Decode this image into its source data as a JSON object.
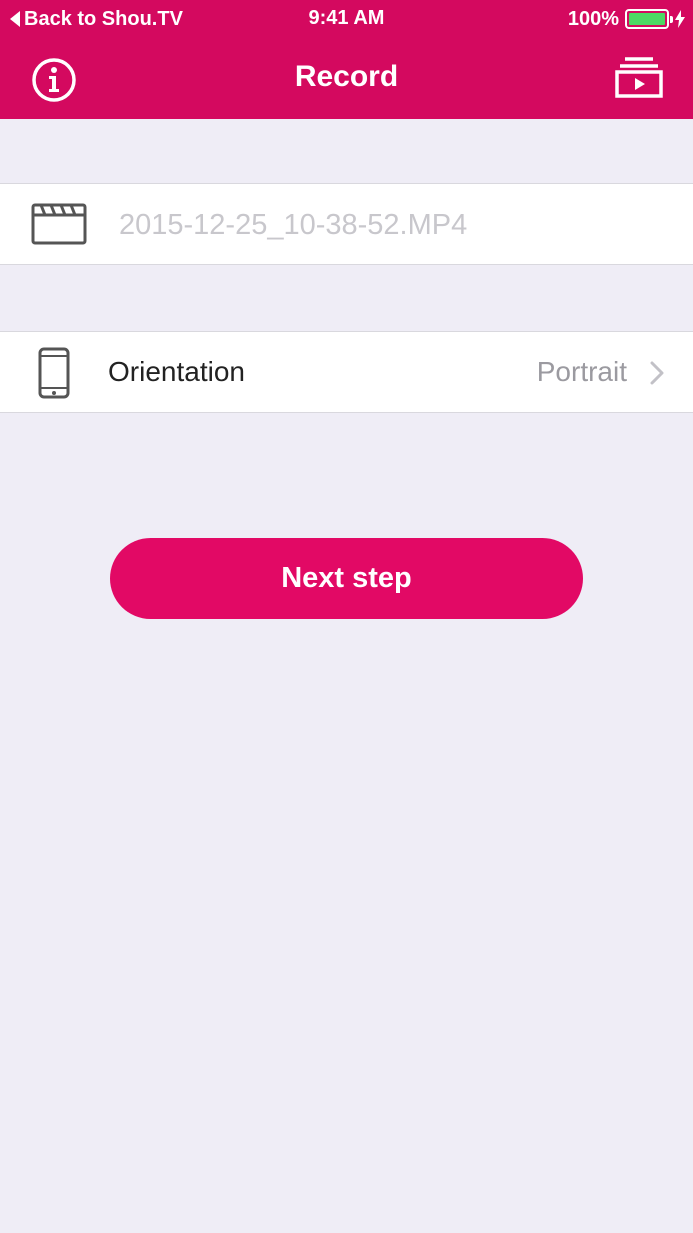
{
  "status_bar": {
    "back_app": "Back to Shou.TV",
    "time": "9:41 AM",
    "battery": "100%",
    "battery_level": 1.0
  },
  "nav": {
    "title": "Record",
    "left_icon": "info-icon",
    "right_icon": "video-library-icon"
  },
  "file": {
    "icon": "clapperboard-icon",
    "placeholder": "2015-12-25_10-38-52.MP4",
    "value": ""
  },
  "orientation": {
    "icon": "phone-icon",
    "label": "Orientation",
    "value": "Portrait"
  },
  "next_button": {
    "label": "Next step"
  },
  "colors": {
    "accent": "#d4095f",
    "button": "#e20965",
    "background": "#efedf6",
    "battery_fill": "#4cd964"
  }
}
